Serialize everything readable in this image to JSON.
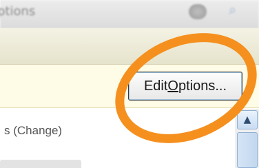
{
  "header": {
    "title_fragment": "ptions"
  },
  "info_bar": {
    "button_label_before": "Edit ",
    "button_label_mnemonic": "O",
    "button_label_after": "ptions..."
  },
  "content": {
    "change_text": "s (Change)"
  },
  "icons": {
    "search": "search-icon",
    "round_button": "circle-button-icon",
    "scroll_up": "chevron-up-icon"
  },
  "colors": {
    "highlight": "#f5901e",
    "info_bar_bg": "#fefbe6"
  }
}
